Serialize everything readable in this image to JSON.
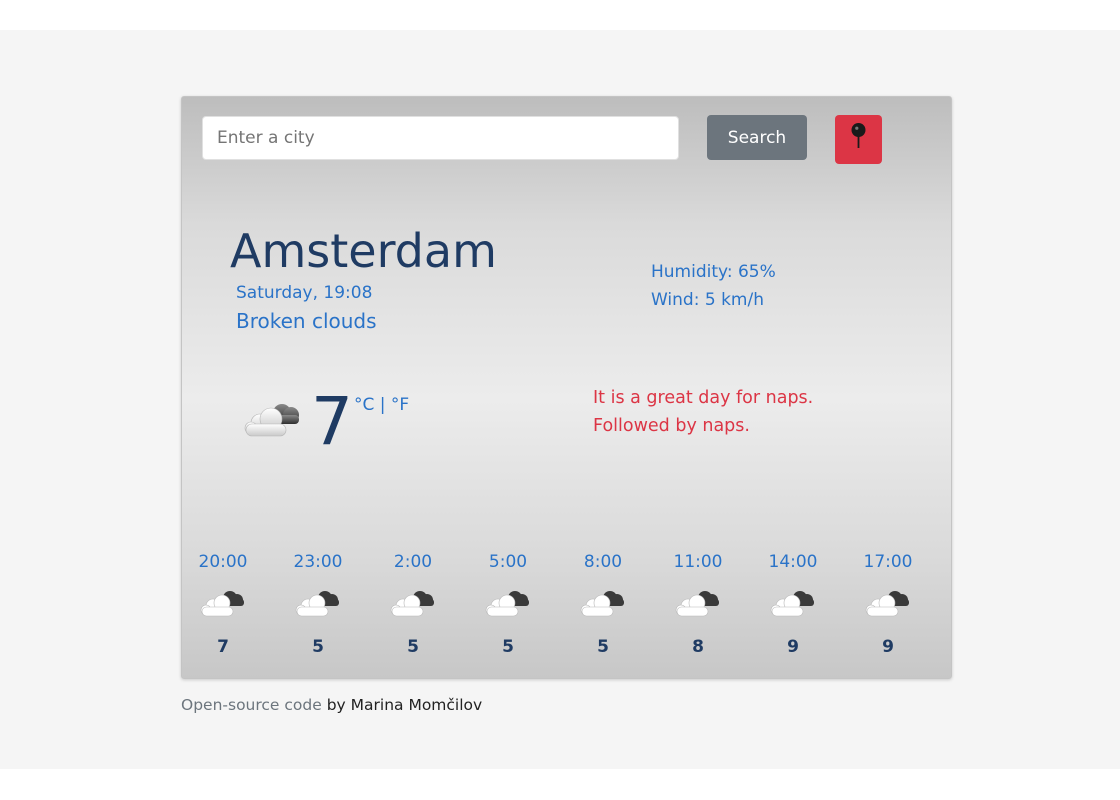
{
  "search": {
    "placeholder": "Enter a city",
    "value": "",
    "button_label": "Search"
  },
  "location_button": {
    "icon": "map-pin-icon",
    "color": "#dc3545"
  },
  "current": {
    "city": "Amsterdam",
    "date_time": "Saturday, 19:08",
    "description": "Broken clouds",
    "humidity": "Humidity: 65%",
    "wind": "Wind: 5 km/h",
    "temperature": "7",
    "unit_celsius": "°C",
    "unit_separator": "|",
    "unit_fahrenheit": "°F",
    "icon": "broken-clouds-icon",
    "message_line1": "It is a great day for naps.",
    "message_line2": "Followed by naps."
  },
  "forecast": [
    {
      "time": "20:00",
      "temp": "7",
      "icon": "broken-clouds-icon"
    },
    {
      "time": "23:00",
      "temp": "5",
      "icon": "broken-clouds-icon"
    },
    {
      "time": "2:00",
      "temp": "5",
      "icon": "broken-clouds-icon"
    },
    {
      "time": "5:00",
      "temp": "5",
      "icon": "broken-clouds-icon"
    },
    {
      "time": "8:00",
      "temp": "5",
      "icon": "broken-clouds-icon"
    },
    {
      "time": "11:00",
      "temp": "8",
      "icon": "broken-clouds-icon"
    },
    {
      "time": "14:00",
      "temp": "9",
      "icon": "broken-clouds-icon"
    },
    {
      "time": "17:00",
      "temp": "9",
      "icon": "broken-clouds-icon"
    }
  ],
  "footer": {
    "link_text": "Open-source code",
    "author_text": " by Marina Momčilov"
  },
  "colors": {
    "accent_blue": "#2a73c8",
    "dark_navy": "#1f3b63",
    "danger_red": "#dc3545",
    "secondary_gray": "#6c757d"
  }
}
